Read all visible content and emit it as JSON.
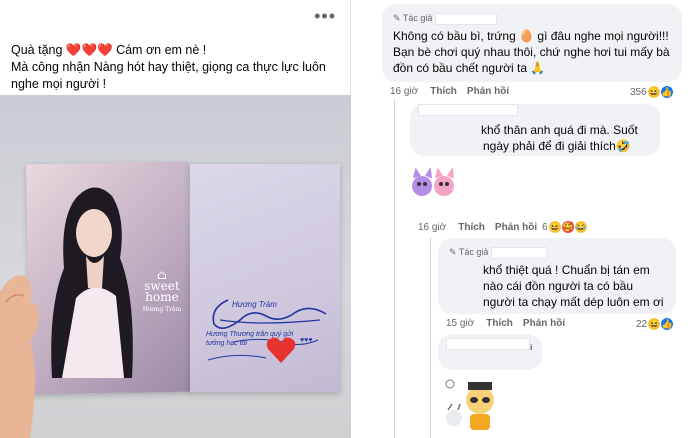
{
  "post": {
    "more_icon": "•••",
    "caption_line1_pre": "Quà tặng ",
    "caption_hearts": "❤️❤️❤️",
    "caption_line1_post": " Cám ơn em nè !",
    "caption_line2": "Mà công nhận Nàng hót hay thiệt, giọng ca thực lực luôn nghe mọi người !",
    "photo": {
      "album_brand": "sweet home",
      "album_artist": "Hương Tràm",
      "signature": "Hương Tràm",
      "handwriting": "Hương Thương trân quý gửi tướng hạc tôi",
      "handwriting_hearts": "♥♥♥"
    }
  },
  "comments": [
    {
      "author_tag": "Tác giả",
      "text": "Không có bầu bì, trứng 🥚 gì đâu nghe mọi người!!! Bạn bè chơi quý nhau thôi, chứ nghe hơi tui mấy bà đồn có bầu chết người ta 🙏",
      "time": "16 giờ",
      "like": "Thích",
      "reply": "Phản hồi",
      "reaction_count": "356"
    },
    {
      "text": "khổ thân anh quá đi mà. Suốt ngày phải để đi giải thích🤣",
      "time": "16 giờ",
      "like": "Thích",
      "reply": "Phản hồi",
      "reaction_count": "6"
    },
    {
      "author_tag": "Tác giả",
      "text": "khổ thiệt quá ! Chuẩn bị tán em nào cái đồn người ta có bầu người ta chạy mất dép luôn em ơi",
      "time": "15 giờ",
      "like": "Thích",
      "reply": "Phản hồi",
      "reaction_count": "22"
    },
    {
      "text": "i"
    }
  ],
  "icons": {
    "author": "pencil-icon",
    "haha": "haha-reaction-icon",
    "like": "like-reaction-icon",
    "love": "love-reaction-icon"
  }
}
